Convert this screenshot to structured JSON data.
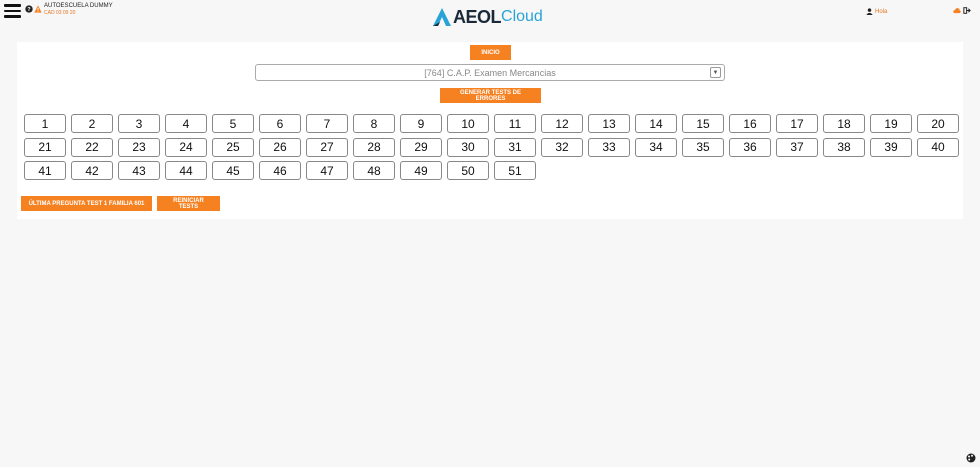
{
  "header": {
    "menu_icon": "hamburger-menu-icon",
    "help_icon": "question-circle-icon",
    "warning_icon": "warning-icon",
    "school_name": "AUTOESCUELA DUMMY",
    "school_sub": "CAD 03 09 20",
    "logo_text": "AEOL",
    "logo_suffix": "Cloud",
    "user_greeting": "Hola",
    "colors": {
      "accent": "#f68121",
      "logo_dark": "#1b2a38",
      "logo_blue": "#29a3d6"
    }
  },
  "main": {
    "inicio_label": "INICIO",
    "select_value": "[764] C.A.P. Examen Mercancias",
    "errores_label": "GENERAR TESTS DE ERRORES",
    "tests": [
      "1",
      "2",
      "3",
      "4",
      "5",
      "6",
      "7",
      "8",
      "9",
      "10",
      "11",
      "12",
      "13",
      "14",
      "15",
      "16",
      "17",
      "18",
      "19",
      "20",
      "21",
      "22",
      "23",
      "24",
      "25",
      "26",
      "27",
      "28",
      "29",
      "30",
      "31",
      "32",
      "33",
      "34",
      "35",
      "36",
      "37",
      "38",
      "39",
      "40",
      "41",
      "42",
      "43",
      "44",
      "45",
      "46",
      "47",
      "48",
      "49",
      "50",
      "51"
    ],
    "ultima_label": "ÚLTIMA PREGUNTA TEST 1 FAMILIA 601",
    "reiniciar_label": "REINICIAR TESTS"
  }
}
